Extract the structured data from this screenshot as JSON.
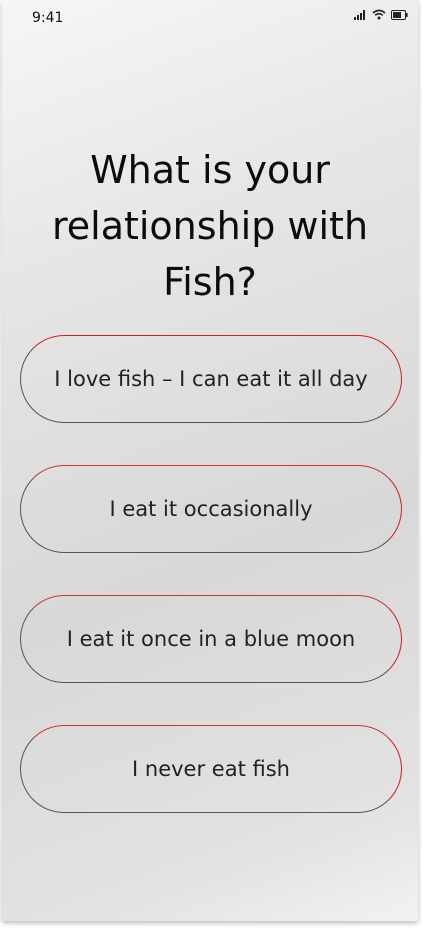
{
  "status_bar": {
    "time": "9:41",
    "icons": [
      "signal-icon",
      "wifi-icon",
      "battery-icon"
    ]
  },
  "question": {
    "lines": [
      "What is your",
      "relationship with",
      "Fish?"
    ]
  },
  "options": [
    {
      "label": "I love fish – I can eat it all day"
    },
    {
      "label": "I eat it occasionally"
    },
    {
      "label": "I eat it once in a blue moon"
    },
    {
      "label": "I never eat fish"
    }
  ],
  "colors": {
    "option_border_accent": "#d21d1d",
    "option_border": "#555555",
    "text": "#0b0b0b"
  }
}
